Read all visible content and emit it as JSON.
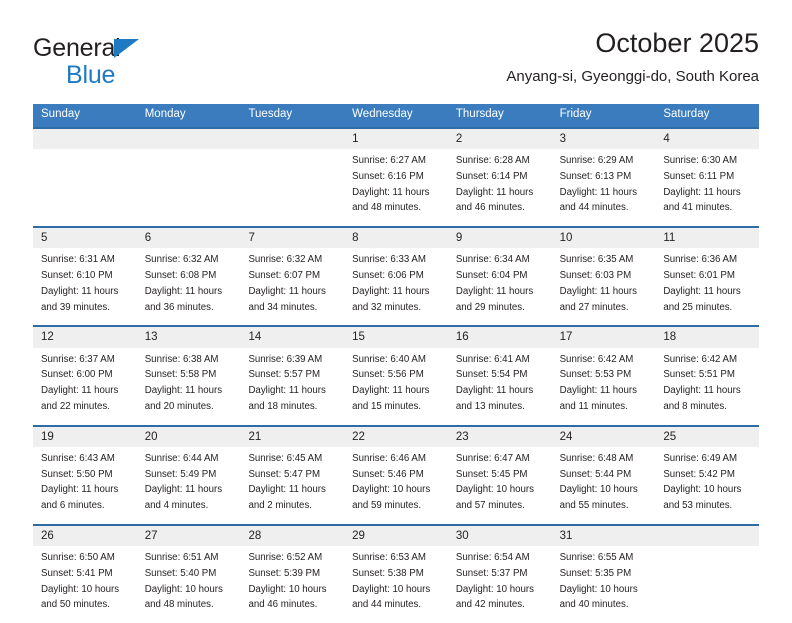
{
  "brand": {
    "line1": "General",
    "line2": "Blue",
    "triangle_color": "#1f7ac4",
    "text_color": "#231f20"
  },
  "header": {
    "title": "October 2025",
    "subtitle": "Anyang-si, Gyeonggi-do, South Korea"
  },
  "theme": {
    "header_blue": "#3a7cbd",
    "border_blue": "#2e6da4",
    "daynum_band": "#efefef",
    "text": "#231f20"
  },
  "weekdays": [
    "Sunday",
    "Monday",
    "Tuesday",
    "Wednesday",
    "Thursday",
    "Friday",
    "Saturday"
  ],
  "weeks": [
    [
      {
        "day": "",
        "lines": []
      },
      {
        "day": "",
        "lines": []
      },
      {
        "day": "",
        "lines": []
      },
      {
        "day": "1",
        "lines": [
          "Sunrise: 6:27 AM",
          "Sunset: 6:16 PM",
          "Daylight: 11 hours",
          "and 48 minutes."
        ]
      },
      {
        "day": "2",
        "lines": [
          "Sunrise: 6:28 AM",
          "Sunset: 6:14 PM",
          "Daylight: 11 hours",
          "and 46 minutes."
        ]
      },
      {
        "day": "3",
        "lines": [
          "Sunrise: 6:29 AM",
          "Sunset: 6:13 PM",
          "Daylight: 11 hours",
          "and 44 minutes."
        ]
      },
      {
        "day": "4",
        "lines": [
          "Sunrise: 6:30 AM",
          "Sunset: 6:11 PM",
          "Daylight: 11 hours",
          "and 41 minutes."
        ]
      }
    ],
    [
      {
        "day": "5",
        "lines": [
          "Sunrise: 6:31 AM",
          "Sunset: 6:10 PM",
          "Daylight: 11 hours",
          "and 39 minutes."
        ]
      },
      {
        "day": "6",
        "lines": [
          "Sunrise: 6:32 AM",
          "Sunset: 6:08 PM",
          "Daylight: 11 hours",
          "and 36 minutes."
        ]
      },
      {
        "day": "7",
        "lines": [
          "Sunrise: 6:32 AM",
          "Sunset: 6:07 PM",
          "Daylight: 11 hours",
          "and 34 minutes."
        ]
      },
      {
        "day": "8",
        "lines": [
          "Sunrise: 6:33 AM",
          "Sunset: 6:06 PM",
          "Daylight: 11 hours",
          "and 32 minutes."
        ]
      },
      {
        "day": "9",
        "lines": [
          "Sunrise: 6:34 AM",
          "Sunset: 6:04 PM",
          "Daylight: 11 hours",
          "and 29 minutes."
        ]
      },
      {
        "day": "10",
        "lines": [
          "Sunrise: 6:35 AM",
          "Sunset: 6:03 PM",
          "Daylight: 11 hours",
          "and 27 minutes."
        ]
      },
      {
        "day": "11",
        "lines": [
          "Sunrise: 6:36 AM",
          "Sunset: 6:01 PM",
          "Daylight: 11 hours",
          "and 25 minutes."
        ]
      }
    ],
    [
      {
        "day": "12",
        "lines": [
          "Sunrise: 6:37 AM",
          "Sunset: 6:00 PM",
          "Daylight: 11 hours",
          "and 22 minutes."
        ]
      },
      {
        "day": "13",
        "lines": [
          "Sunrise: 6:38 AM",
          "Sunset: 5:58 PM",
          "Daylight: 11 hours",
          "and 20 minutes."
        ]
      },
      {
        "day": "14",
        "lines": [
          "Sunrise: 6:39 AM",
          "Sunset: 5:57 PM",
          "Daylight: 11 hours",
          "and 18 minutes."
        ]
      },
      {
        "day": "15",
        "lines": [
          "Sunrise: 6:40 AM",
          "Sunset: 5:56 PM",
          "Daylight: 11 hours",
          "and 15 minutes."
        ]
      },
      {
        "day": "16",
        "lines": [
          "Sunrise: 6:41 AM",
          "Sunset: 5:54 PM",
          "Daylight: 11 hours",
          "and 13 minutes."
        ]
      },
      {
        "day": "17",
        "lines": [
          "Sunrise: 6:42 AM",
          "Sunset: 5:53 PM",
          "Daylight: 11 hours",
          "and 11 minutes."
        ]
      },
      {
        "day": "18",
        "lines": [
          "Sunrise: 6:42 AM",
          "Sunset: 5:51 PM",
          "Daylight: 11 hours",
          "and 8 minutes."
        ]
      }
    ],
    [
      {
        "day": "19",
        "lines": [
          "Sunrise: 6:43 AM",
          "Sunset: 5:50 PM",
          "Daylight: 11 hours",
          "and 6 minutes."
        ]
      },
      {
        "day": "20",
        "lines": [
          "Sunrise: 6:44 AM",
          "Sunset: 5:49 PM",
          "Daylight: 11 hours",
          "and 4 minutes."
        ]
      },
      {
        "day": "21",
        "lines": [
          "Sunrise: 6:45 AM",
          "Sunset: 5:47 PM",
          "Daylight: 11 hours",
          "and 2 minutes."
        ]
      },
      {
        "day": "22",
        "lines": [
          "Sunrise: 6:46 AM",
          "Sunset: 5:46 PM",
          "Daylight: 10 hours",
          "and 59 minutes."
        ]
      },
      {
        "day": "23",
        "lines": [
          "Sunrise: 6:47 AM",
          "Sunset: 5:45 PM",
          "Daylight: 10 hours",
          "and 57 minutes."
        ]
      },
      {
        "day": "24",
        "lines": [
          "Sunrise: 6:48 AM",
          "Sunset: 5:44 PM",
          "Daylight: 10 hours",
          "and 55 minutes."
        ]
      },
      {
        "day": "25",
        "lines": [
          "Sunrise: 6:49 AM",
          "Sunset: 5:42 PM",
          "Daylight: 10 hours",
          "and 53 minutes."
        ]
      }
    ],
    [
      {
        "day": "26",
        "lines": [
          "Sunrise: 6:50 AM",
          "Sunset: 5:41 PM",
          "Daylight: 10 hours",
          "and 50 minutes."
        ]
      },
      {
        "day": "27",
        "lines": [
          "Sunrise: 6:51 AM",
          "Sunset: 5:40 PM",
          "Daylight: 10 hours",
          "and 48 minutes."
        ]
      },
      {
        "day": "28",
        "lines": [
          "Sunrise: 6:52 AM",
          "Sunset: 5:39 PM",
          "Daylight: 10 hours",
          "and 46 minutes."
        ]
      },
      {
        "day": "29",
        "lines": [
          "Sunrise: 6:53 AM",
          "Sunset: 5:38 PM",
          "Daylight: 10 hours",
          "and 44 minutes."
        ]
      },
      {
        "day": "30",
        "lines": [
          "Sunrise: 6:54 AM",
          "Sunset: 5:37 PM",
          "Daylight: 10 hours",
          "and 42 minutes."
        ]
      },
      {
        "day": "31",
        "lines": [
          "Sunrise: 6:55 AM",
          "Sunset: 5:35 PM",
          "Daylight: 10 hours",
          "and 40 minutes."
        ]
      },
      {
        "day": "",
        "lines": []
      }
    ]
  ]
}
